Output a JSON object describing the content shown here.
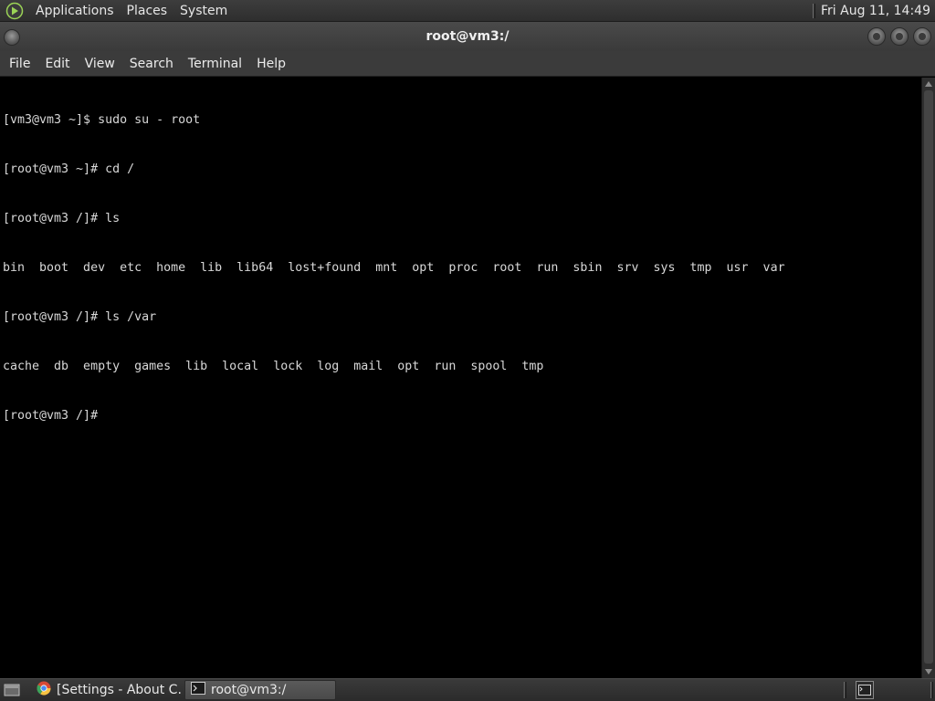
{
  "top_panel": {
    "menus": [
      "Applications",
      "Places",
      "System"
    ],
    "clock": "Fri Aug 11, 14:49",
    "logo_icon": "mate-logo-icon"
  },
  "window": {
    "title": "root@vm3:/",
    "menu": [
      "File",
      "Edit",
      "View",
      "Search",
      "Terminal",
      "Help"
    ]
  },
  "terminal": {
    "lines": [
      "[vm3@vm3 ~]$ sudo su - root",
      "[root@vm3 ~]# cd /",
      "[root@vm3 /]# ls",
      "bin  boot  dev  etc  home  lib  lib64  lost+found  mnt  opt  proc  root  run  sbin  srv  sys  tmp  usr  var",
      "[root@vm3 /]# ls /var",
      "cache  db  empty  games  lib  local  lock  log  mail  opt  run  spool  tmp",
      "[root@vm3 /]#"
    ]
  },
  "taskbar": {
    "tasks": [
      {
        "label": "[Settings - About C...",
        "icon": "chrome-icon",
        "active": false
      },
      {
        "label": "root@vm3:/",
        "icon": "terminal-icon",
        "active": true
      }
    ]
  },
  "colors": {
    "terminal_bg": "#000000",
    "terminal_fg": "#d8d8d8",
    "panel_bg": "#333333"
  }
}
